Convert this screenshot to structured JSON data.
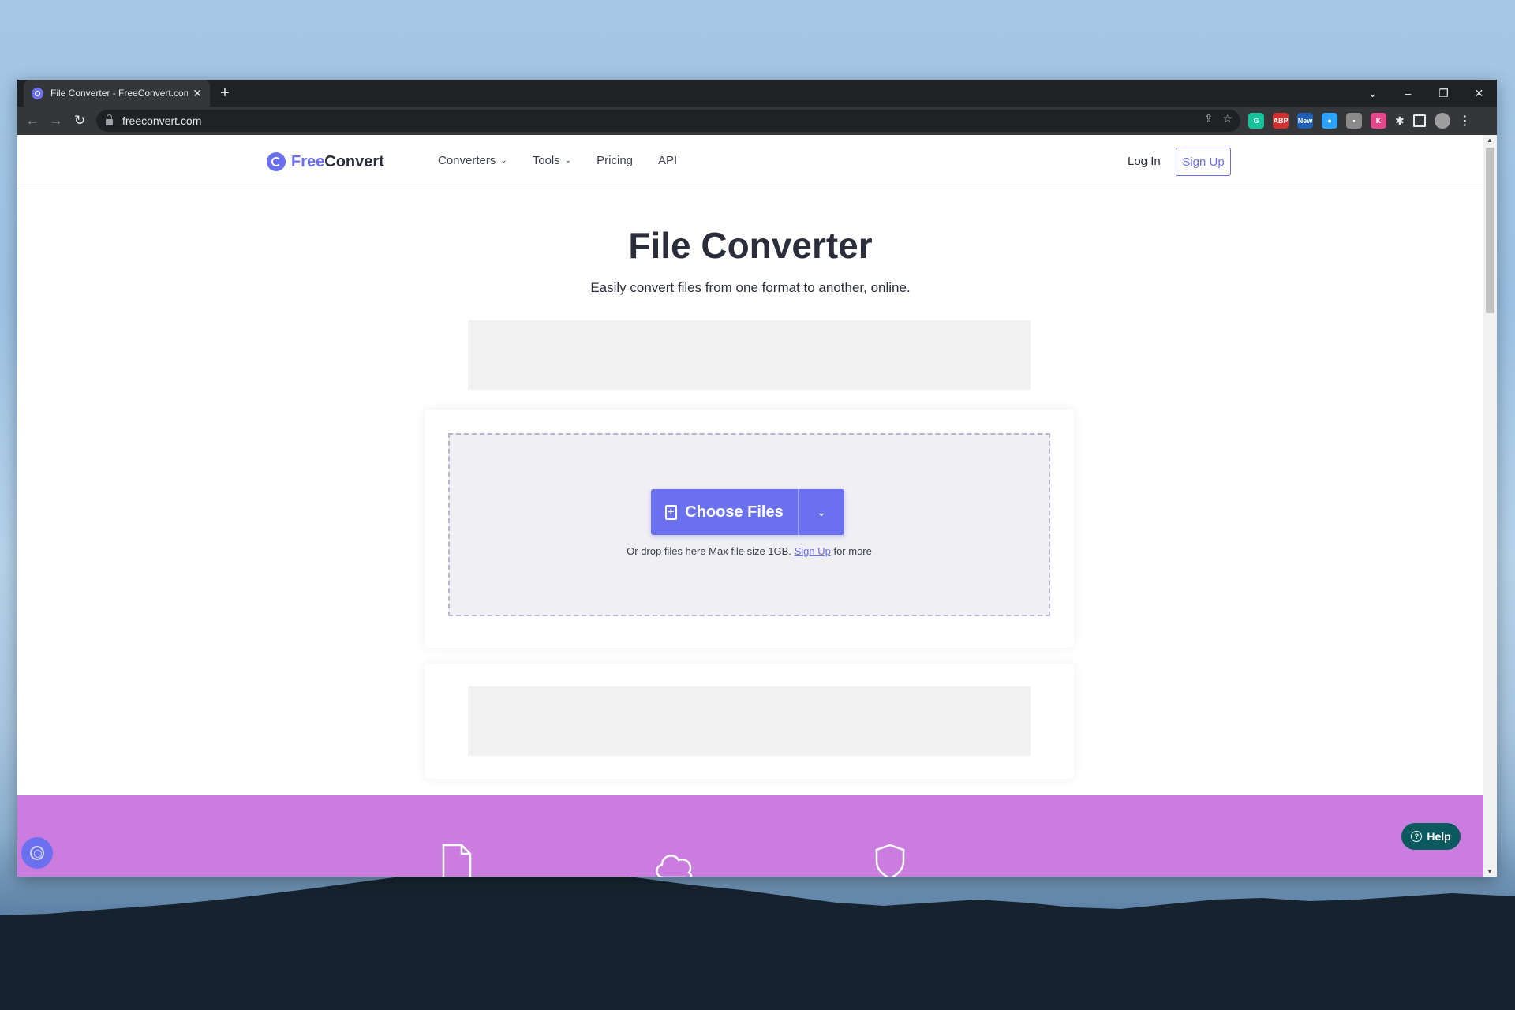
{
  "browser": {
    "tab_title": "File Converter - FreeConvert.com",
    "tab_close": "✕",
    "new_tab": "+",
    "url": "freeconvert.com",
    "extensions": [
      {
        "name": "grammarly",
        "label": "G",
        "color": "#15c39a"
      },
      {
        "name": "adblock",
        "label": "ABP",
        "color": "#d32f2f"
      },
      {
        "name": "news",
        "label": "New",
        "color": "#1e5fb4"
      },
      {
        "name": "chat",
        "label": "●",
        "color": "#29a3ff"
      },
      {
        "name": "grey-ext",
        "label": "▪",
        "color": "#8a8a8a"
      },
      {
        "name": "k-ext",
        "label": "K",
        "color": "#e5488a"
      }
    ]
  },
  "site": {
    "logo_free": "Free",
    "logo_convert": "Convert",
    "nav": {
      "converters": "Converters",
      "tools": "Tools",
      "pricing": "Pricing",
      "api": "API"
    },
    "login": "Log In",
    "signup": "Sign Up"
  },
  "hero": {
    "title": "File Converter",
    "subtitle": "Easily convert files from one format to another, online."
  },
  "upload": {
    "choose_label": "Choose Files",
    "note_prefix": "Or drop files here Max file size 1GB.",
    "note_link": "Sign Up",
    "note_suffix": "for more"
  },
  "widgets": {
    "help": "Help"
  },
  "colors": {
    "accent": "#6b70ee",
    "features_band": "#cb7cdf",
    "help_button": "#0b5a5f"
  }
}
